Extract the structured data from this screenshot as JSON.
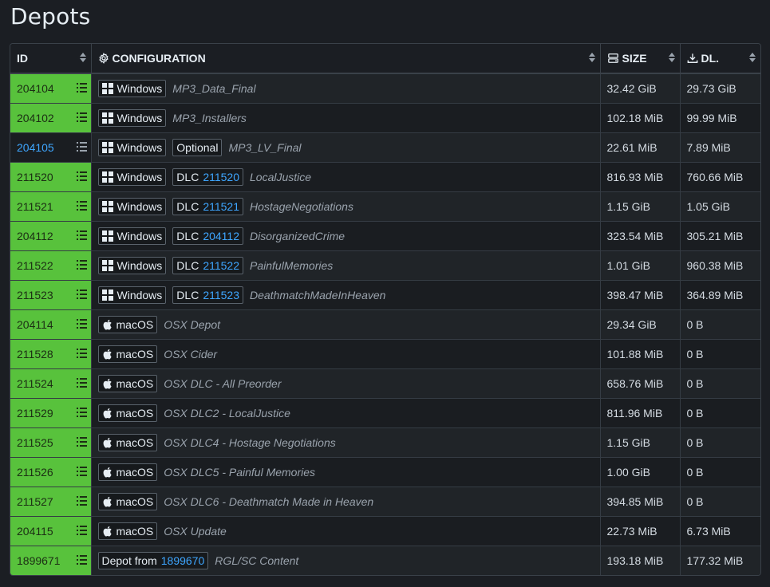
{
  "page_title": "Depots",
  "columns": {
    "id": "ID",
    "configuration": "CONFIGURATION",
    "size": "SIZE",
    "dl": "DL."
  },
  "rows": [
    {
      "id": "204104",
      "highlight": true,
      "os": "Windows",
      "badge": "",
      "badge_link": "",
      "name": "MP3_Data_Final",
      "size": "32.42 GiB",
      "dl": "29.73 GiB"
    },
    {
      "id": "204102",
      "highlight": true,
      "os": "Windows",
      "badge": "",
      "badge_link": "",
      "name": "MP3_Installers",
      "size": "102.18 MiB",
      "dl": "99.99 MiB"
    },
    {
      "id": "204105",
      "highlight": false,
      "os": "Windows",
      "badge": "Optional",
      "badge_link": "",
      "name": "MP3_LV_Final",
      "size": "22.61 MiB",
      "dl": "7.89 MiB"
    },
    {
      "id": "211520",
      "highlight": true,
      "os": "Windows",
      "badge": "DLC",
      "badge_link": "211520",
      "name": "LocalJustice",
      "size": "816.93 MiB",
      "dl": "760.66 MiB"
    },
    {
      "id": "211521",
      "highlight": true,
      "os": "Windows",
      "badge": "DLC",
      "badge_link": "211521",
      "name": "HostageNegotiations",
      "size": "1.15 GiB",
      "dl": "1.05 GiB"
    },
    {
      "id": "204112",
      "highlight": true,
      "os": "Windows",
      "badge": "DLC",
      "badge_link": "204112",
      "name": "DisorganizedCrime",
      "size": "323.54 MiB",
      "dl": "305.21 MiB"
    },
    {
      "id": "211522",
      "highlight": true,
      "os": "Windows",
      "badge": "DLC",
      "badge_link": "211522",
      "name": "PainfulMemories",
      "size": "1.01 GiB",
      "dl": "960.38 MiB"
    },
    {
      "id": "211523",
      "highlight": true,
      "os": "Windows",
      "badge": "DLC",
      "badge_link": "211523",
      "name": "DeathmatchMadeInHeaven",
      "size": "398.47 MiB",
      "dl": "364.89 MiB"
    },
    {
      "id": "204114",
      "highlight": true,
      "os": "macOS",
      "badge": "",
      "badge_link": "",
      "name": "OSX Depot",
      "size": "29.34 GiB",
      "dl": "0 B"
    },
    {
      "id": "211528",
      "highlight": true,
      "os": "macOS",
      "badge": "",
      "badge_link": "",
      "name": "OSX Cider",
      "size": "101.88 MiB",
      "dl": "0 B"
    },
    {
      "id": "211524",
      "highlight": true,
      "os": "macOS",
      "badge": "",
      "badge_link": "",
      "name": "OSX DLC - All Preorder",
      "size": "658.76 MiB",
      "dl": "0 B"
    },
    {
      "id": "211529",
      "highlight": true,
      "os": "macOS",
      "badge": "",
      "badge_link": "",
      "name": "OSX DLC2 - LocalJustice",
      "size": "811.96 MiB",
      "dl": "0 B"
    },
    {
      "id": "211525",
      "highlight": true,
      "os": "macOS",
      "badge": "",
      "badge_link": "",
      "name": "OSX DLC4 - Hostage Negotiations",
      "size": "1.15 GiB",
      "dl": "0 B"
    },
    {
      "id": "211526",
      "highlight": true,
      "os": "macOS",
      "badge": "",
      "badge_link": "",
      "name": "OSX DLC5 - Painful Memories",
      "size": "1.00 GiB",
      "dl": "0 B"
    },
    {
      "id": "211527",
      "highlight": true,
      "os": "macOS",
      "badge": "",
      "badge_link": "",
      "name": "OSX DLC6 - Deathmatch Made in Heaven",
      "size": "394.85 MiB",
      "dl": "0 B"
    },
    {
      "id": "204115",
      "highlight": true,
      "os": "macOS",
      "badge": "",
      "badge_link": "",
      "name": "OSX Update",
      "size": "22.73 MiB",
      "dl": "6.73 MiB"
    },
    {
      "id": "1899671",
      "highlight": true,
      "os": "",
      "badge": "Depot from",
      "badge_link": "1899670",
      "name": "RGL/SC Content",
      "size": "193.18 MiB",
      "dl": "177.32 MiB"
    }
  ],
  "colors": {
    "highlight": "#58c23c",
    "link": "#3ea6ff",
    "background": "#1b1e23"
  }
}
